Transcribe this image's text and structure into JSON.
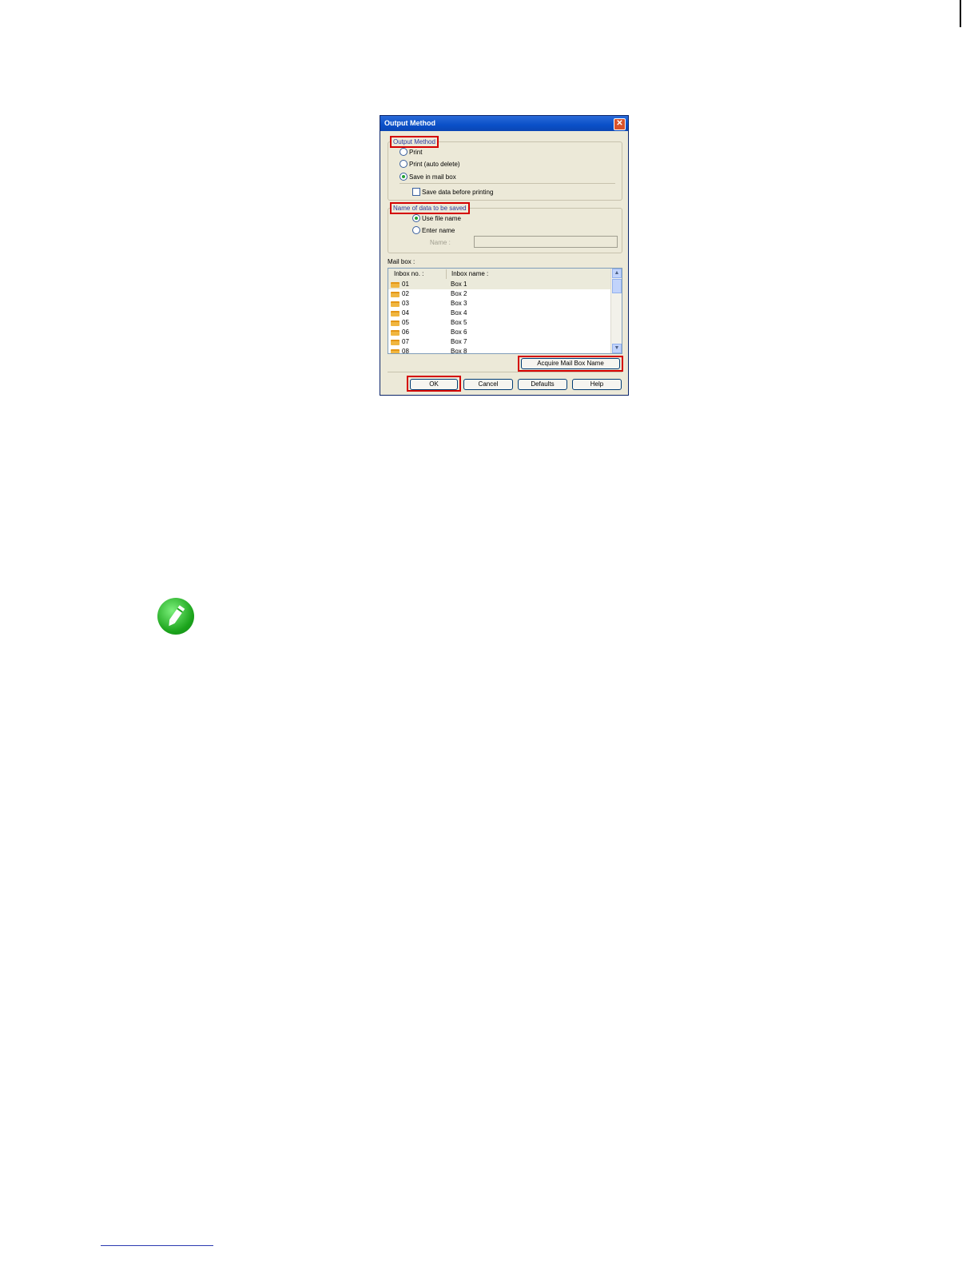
{
  "dialog": {
    "title": "Output Method",
    "close_glyph": "✕",
    "output_group": {
      "legend": "Output Method",
      "options": [
        "Print",
        "Print (auto delete)",
        "Save in mail box"
      ],
      "selected": "Save in mail box",
      "save_before_print": "Save data before printing"
    },
    "name_group": {
      "legend": "Name of data to be saved",
      "use_file_name": "Use file name",
      "enter_name": "Enter name",
      "name_label": "Name :",
      "selected": "Use file name"
    },
    "mailbox": {
      "label": "Mail box :",
      "col_no": "Inbox no. :",
      "col_name": "Inbox name :",
      "rows": [
        {
          "no": "01",
          "name": "Box 1"
        },
        {
          "no": "02",
          "name": "Box 2"
        },
        {
          "no": "03",
          "name": "Box 3"
        },
        {
          "no": "04",
          "name": "Box 4"
        },
        {
          "no": "05",
          "name": "Box 5"
        },
        {
          "no": "06",
          "name": "Box 6"
        },
        {
          "no": "07",
          "name": "Box 7"
        },
        {
          "no": "08",
          "name": "Box 8"
        }
      ],
      "scroll_up": "▲",
      "scroll_down": "▼"
    },
    "acquire_button": "Acquire Mail Box Name",
    "buttons": {
      "ok": "OK",
      "cancel": "Cancel",
      "defaults": "Defaults",
      "help": "Help"
    }
  },
  "icons": {
    "note": "pencil-icon",
    "folder": "folder-icon"
  },
  "colors": {
    "highlight": "#d40000",
    "titlebar": "#0a50c8",
    "note_icon": "#1ba31b"
  }
}
